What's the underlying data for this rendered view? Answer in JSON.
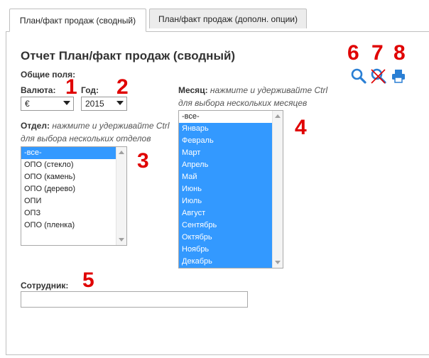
{
  "tabs": [
    {
      "label": "План/факт продаж (сводный)",
      "active": true
    },
    {
      "label": "План/факт продаж (дополн. опции)",
      "active": false
    }
  ],
  "report": {
    "title": "Отчет План/факт продаж (сводный)",
    "general_fields": "Общие поля:"
  },
  "currency": {
    "label": "Валюта:",
    "value": "€"
  },
  "year": {
    "label": "Год:",
    "value": "2015"
  },
  "department": {
    "label": "Отдел:",
    "hint_line1": "нажмите и удерживайте Ctrl",
    "hint_line2": "для выбора нескольких отделов",
    "options": [
      "-все-",
      "ОПО (стекло)",
      "ОПО (камень)",
      "ОПО (дерево)",
      "ОПИ",
      "ОПЗ",
      "ОПО (пленка)"
    ],
    "selected": [
      0
    ]
  },
  "month": {
    "label": "Месяц:",
    "hint_line1": "нажмите и удерживайте Ctrl",
    "hint_line2": "для выбора нескольких месяцев",
    "options": [
      "-все-",
      "Январь",
      "Февраль",
      "Март",
      "Апрель",
      "Май",
      "Июнь",
      "Июль",
      "Август",
      "Сентябрь",
      "Октябрь",
      "Ноябрь",
      "Декабрь"
    ],
    "selected": [
      1,
      2,
      3,
      4,
      5,
      6,
      7,
      8,
      9,
      10,
      11,
      12
    ]
  },
  "employee": {
    "label": "Сотрудник:",
    "value": ""
  },
  "markers": [
    "1",
    "2",
    "3",
    "4",
    "5",
    "6",
    "7",
    "8"
  ],
  "colors": {
    "accent": "#e00000",
    "selection": "#3399ff",
    "icon_blue": "#2a7fd4"
  },
  "icons": [
    "search-icon",
    "clear-filter-icon",
    "print-icon"
  ]
}
